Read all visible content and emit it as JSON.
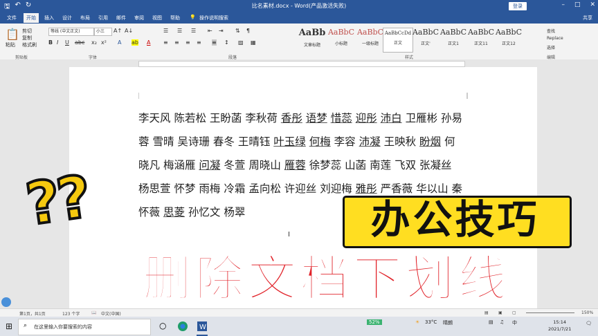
{
  "window": {
    "title": "比名素材.docx - Word(产品激活失败)",
    "login_label": "登录"
  },
  "menu": {
    "tabs": [
      "文件",
      "开始",
      "插入",
      "设计",
      "布局",
      "引用",
      "邮件",
      "审阅",
      "视图",
      "帮助"
    ],
    "active_tab": "开始",
    "tell_me": "操作说明搜索",
    "share": "共享"
  },
  "ribbon": {
    "clipboard": {
      "paste": "粘贴",
      "cut": "剪切",
      "copy": "复制",
      "format_painter": "格式刷",
      "label": "剪贴板"
    },
    "font": {
      "font_name": "等线 (中文正文)",
      "font_size": "小三",
      "label": "字体"
    },
    "paragraph_label": "段落",
    "styles": {
      "label": "样式",
      "items": [
        {
          "preview": "AaBb",
          "name": "文章标题"
        },
        {
          "preview": "AaBbC",
          "name": "小标题"
        },
        {
          "preview": "AaBbC",
          "name": "一级标题"
        },
        {
          "preview": "AaBbCcDd",
          "name": "正文"
        },
        {
          "preview": "AaBbC",
          "name": "正文'"
        },
        {
          "preview": "AaBbC",
          "name": "正文1"
        },
        {
          "preview": "AaBbC",
          "name": "正文11"
        },
        {
          "preview": "AaBbC",
          "name": "正文12"
        }
      ]
    },
    "editing": {
      "find": "查找",
      "replace": "Replace",
      "select": "选择",
      "label": "编辑"
    }
  },
  "document": {
    "names": [
      {
        "text": "李天风",
        "u": false
      },
      {
        "text": "陈若松",
        "u": false
      },
      {
        "text": "王盼菡",
        "u": false
      },
      {
        "text": "李秋荷",
        "u": false
      },
      {
        "text": "香彤",
        "u": true
      },
      {
        "text": "语梦",
        "u": true
      },
      {
        "text": "惜蕊",
        "u": true
      },
      {
        "text": "迎彤",
        "u": true
      },
      {
        "text": "沛白",
        "u": true
      },
      {
        "text": "卫雁彬",
        "u": false
      },
      {
        "text": "孙易蓉",
        "u": false
      },
      {
        "text": "雪晴",
        "u": false
      },
      {
        "text": "吴诗珊",
        "u": false
      },
      {
        "text": "春冬",
        "u": false
      },
      {
        "text": "王晴钰",
        "u": false
      },
      {
        "text": "叶玉绿",
        "u": true
      },
      {
        "text": "何梅",
        "u": true
      },
      {
        "text": "李容",
        "u": false
      },
      {
        "text": "沛凝",
        "u": true
      },
      {
        "text": "王映秋",
        "u": false
      },
      {
        "text": "盼烟",
        "u": true
      },
      {
        "text": "何晓凡",
        "u": false
      },
      {
        "text": "梅涵雁",
        "u": false
      },
      {
        "text": "问凝",
        "u": true
      },
      {
        "text": "冬萱",
        "u": false
      },
      {
        "text": "周晓山",
        "u": false
      },
      {
        "text": "雁蓉",
        "u": true
      },
      {
        "text": "徐梦蕊",
        "u": false
      },
      {
        "text": "山菡",
        "u": false
      },
      {
        "text": "南莲",
        "u": false
      },
      {
        "text": "飞双",
        "u": false
      },
      {
        "text": "张凝丝",
        "u": false
      },
      {
        "text": "杨思萱",
        "u": false
      },
      {
        "text": "怀梦",
        "u": false
      },
      {
        "text": "雨梅",
        "u": false
      },
      {
        "text": "冷霜",
        "u": false
      },
      {
        "text": "孟向松",
        "u": false
      },
      {
        "text": "许迎丝",
        "u": false
      },
      {
        "text": "刘迎梅",
        "u": false
      },
      {
        "text": "雅彤",
        "u": true
      },
      {
        "text": "严香薇",
        "u": false
      },
      {
        "text": "华以山",
        "u": false
      },
      {
        "text": "秦",
        "u": false
      },
      {
        "text": "怀薇",
        "u": false
      },
      {
        "text": "思菱",
        "u": true
      },
      {
        "text": "孙忆文",
        "u": false
      },
      {
        "text": "杨翠",
        "u": false
      }
    ]
  },
  "overlay": {
    "marks": "??",
    "badge": "办公技巧",
    "title": "删除文档下划线"
  },
  "status": {
    "page": "第1页，共1页",
    "words": "123 个字",
    "language": "中文(中国)",
    "zoom": "150%"
  },
  "taskbar": {
    "search_placeholder": "在这里输入你要搜索的内容",
    "battery": "52%",
    "temperature": "33°C",
    "weather": "晴朗",
    "ime": "中",
    "time": "15:14",
    "date": "2021/7/21"
  }
}
